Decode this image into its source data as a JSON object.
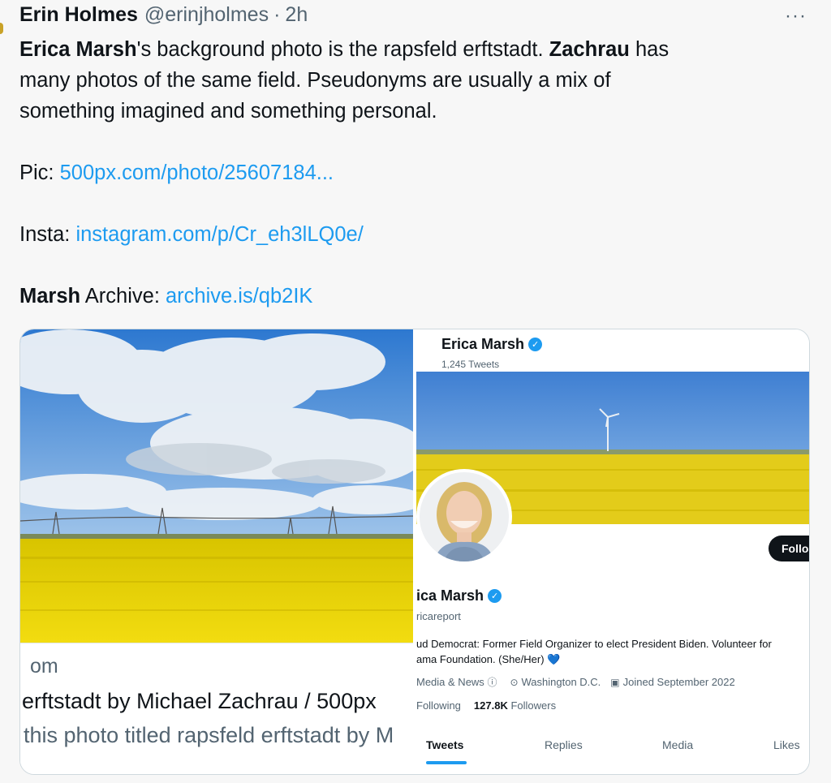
{
  "tweet": {
    "author_name": "Erin Holmes",
    "author_handle": "@erinjholmes",
    "separator": "·",
    "timestamp": "2h",
    "more": "···",
    "line1_bold_a": "Erica Marsh",
    "line1_text_a": "'s background photo is the rapsfeld erftstadt. ",
    "line1_bold_b": "Zachrau",
    "line1_text_b": " has",
    "line2": "many photos of the same field. Pseudonyms are usually a mix of",
    "line3": "something imagined and something personal.",
    "pic_label": "Pic: ",
    "pic_link": "500px.com/photo/25607184...",
    "insta_label": "Insta: ",
    "insta_link": "instagram.com/p/Cr_eh3lLQ0e/",
    "archive_bold": "Marsh",
    "archive_label": " Archive: ",
    "archive_link": "archive.is/qb2IK"
  },
  "left_card": {
    "caption_domain": "om",
    "caption_title": "erftstadt by Michael Zachrau / 500px",
    "caption_desc": "this photo titled rapsfeld erftstadt by M"
  },
  "right_card": {
    "profile_name": "Erica Marsh",
    "tweet_count": "1,245 Tweets",
    "follow_label": "Follo",
    "display_name": "ica Marsh",
    "handle": "ricareport",
    "bio_line1": "ud Democrat: Former Field Organizer to elect President Biden. Volunteer for",
    "bio_line2": "ama Foundation. (She/Her)",
    "heart": "💙",
    "category": "Media & News",
    "location": "Washington D.C.",
    "joined": "Joined September 2022",
    "following_label": "Following",
    "followers_count": "127.8K",
    "followers_label": "Followers",
    "tabs": [
      "Tweets",
      "Replies",
      "Media",
      "Likes"
    ],
    "verified_mark": "✓",
    "info_mark": "ⓘ",
    "pin_mark": "⊙",
    "cal_mark": "▣"
  },
  "colors": {
    "link": "#1d9bf0",
    "field_yellow": "#e8d000",
    "sky": "#3f86d8"
  }
}
